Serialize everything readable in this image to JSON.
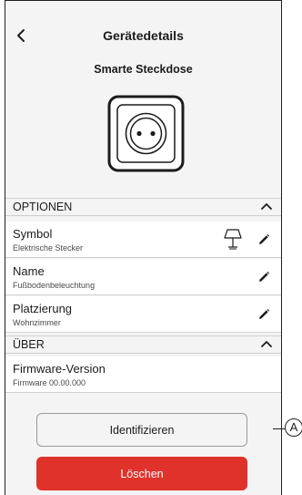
{
  "header": {
    "title": "Gerätedetails",
    "subtitle": "Smarte Steckdose"
  },
  "icons": {
    "back": "chevron-left-icon",
    "device": "socket-icon",
    "collapse": "chevron-up-icon",
    "edit": "pencil-icon",
    "symbol": "lamp-icon"
  },
  "sections": {
    "options": {
      "label": "OPTIONEN"
    },
    "about": {
      "label": "ÜBER"
    }
  },
  "rows": {
    "symbol": {
      "label": "Symbol",
      "value": "Elektrische Stecker"
    },
    "name": {
      "label": "Name",
      "value": "Fußbodenbeleuchtung"
    },
    "placement": {
      "label": "Platzierung",
      "value": "Wohnzimmer"
    },
    "firmware": {
      "label": "Firmware-Version",
      "value": "Firmware 00.00.000"
    }
  },
  "buttons": {
    "identify": "Identifizieren",
    "delete": "Löschen"
  },
  "callout": "A",
  "colors": {
    "delete_bg": "#e0322b",
    "background": "#f4f4f4"
  }
}
